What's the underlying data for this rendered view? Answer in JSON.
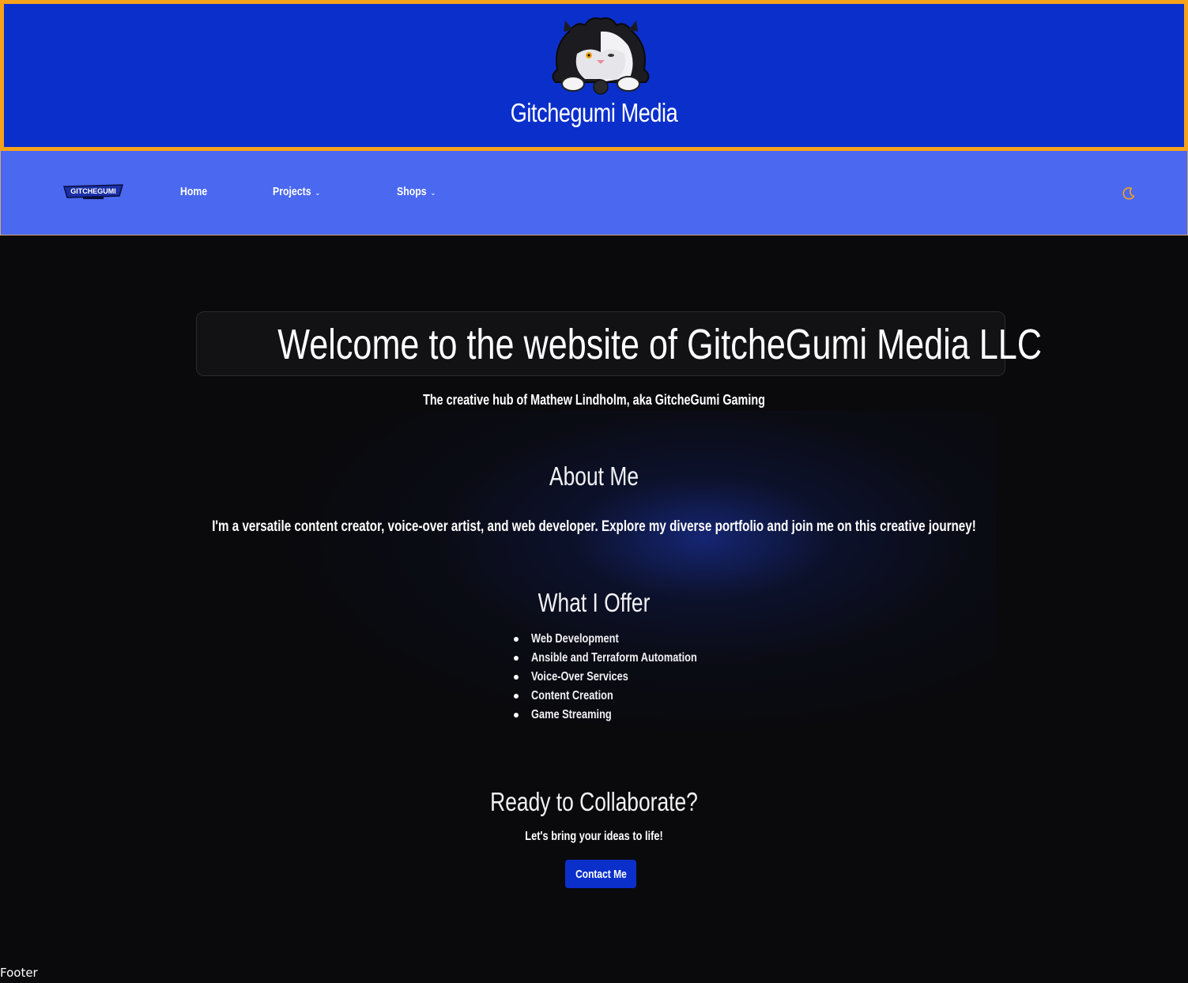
{
  "header": {
    "site_title": "Gitchegumi Media",
    "colors": {
      "background": "#0b2fcb",
      "border": "#f7a21b"
    }
  },
  "nav": {
    "logo_text": "GITCHEGUMI",
    "items": [
      {
        "label": "Home"
      },
      {
        "label": "Projects",
        "dropdown": true
      },
      {
        "label": "Shops",
        "dropdown": true
      }
    ],
    "theme_toggle_icon": "moon-icon",
    "colors": {
      "background": "#4a68f0",
      "accent": "#f7a21b"
    }
  },
  "hero": {
    "title": "Welcome to the website of GitcheGumi Media LLC",
    "tagline": "The creative hub of Mathew Lindholm, aka GitcheGumi Gaming"
  },
  "about": {
    "heading": "About Me",
    "text": "I'm a versatile content creator, voice-over artist, and web developer. Explore my diverse portfolio and join me on this creative journey!"
  },
  "offer": {
    "heading": "What I Offer",
    "items": [
      "Web Development",
      "Ansible and Terraform Automation",
      "Voice-Over Services",
      "Content Creation",
      "Game Streaming"
    ]
  },
  "cta": {
    "heading": "Ready to Collaborate?",
    "subtext": "Let's bring your ideas to life!",
    "button_label": "Contact Me"
  },
  "footer": {
    "text": "Footer"
  }
}
